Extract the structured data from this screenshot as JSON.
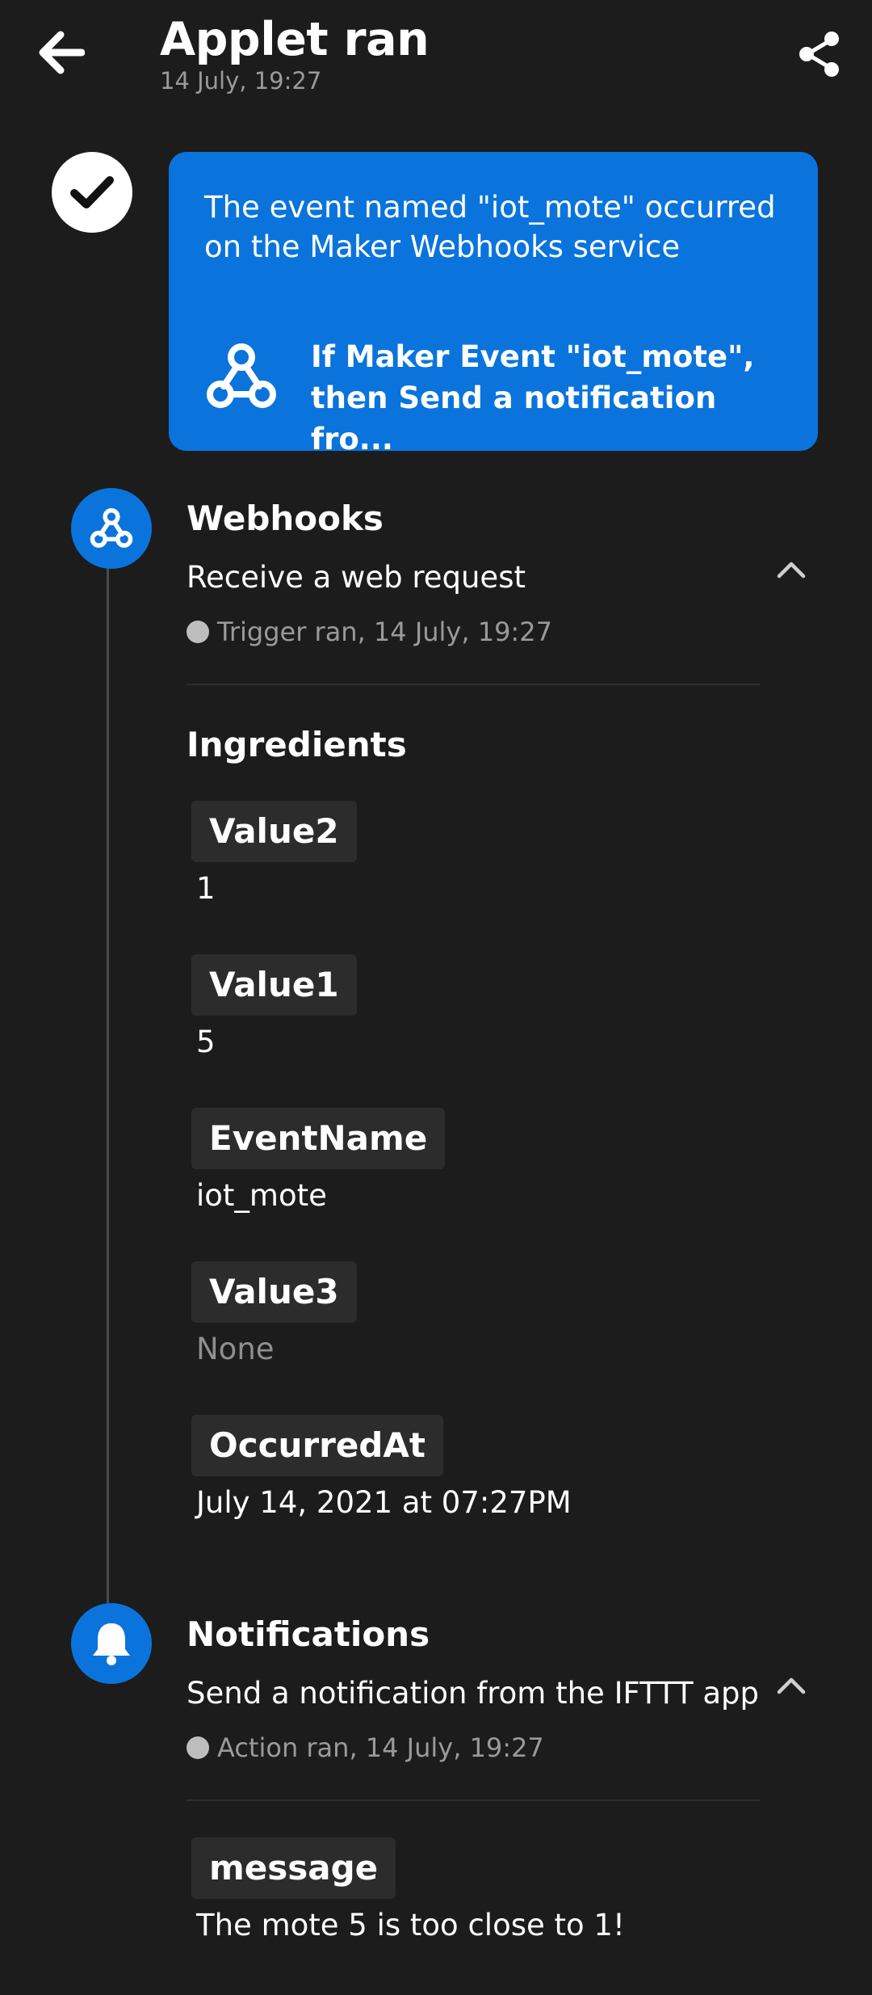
{
  "header": {
    "title": "Applet ran",
    "subtitle": "14 July, 19:27"
  },
  "summary": {
    "text": "The event named \"iot_mote\" occurred on the Maker Webhooks service",
    "applet_name": "If Maker Event \"iot_mote\", then Send a notification fro..."
  },
  "trigger": {
    "service": "Webhooks",
    "description": "Receive a web request",
    "meta": "Trigger ran, 14 July, 19:27",
    "ingredients_heading": "Ingredients",
    "ingredients": [
      {
        "label": "Value2",
        "value": "1"
      },
      {
        "label": "Value1",
        "value": "5"
      },
      {
        "label": "EventName",
        "value": "iot_mote"
      },
      {
        "label": "Value3",
        "value": "None"
      },
      {
        "label": "OccurredAt",
        "value": "July 14, 2021 at 07:27PM"
      }
    ]
  },
  "action": {
    "service": "Notifications",
    "description": "Send a notification from the IFTTT app",
    "meta": "Action ran, 14 July, 19:27",
    "fields": [
      {
        "label": "message",
        "value": "The mote 5 is too close to 1!"
      }
    ]
  },
  "colors": {
    "background": "#1c1c1c",
    "accent": "#0a74dc",
    "muted": "#9a9a9a"
  }
}
